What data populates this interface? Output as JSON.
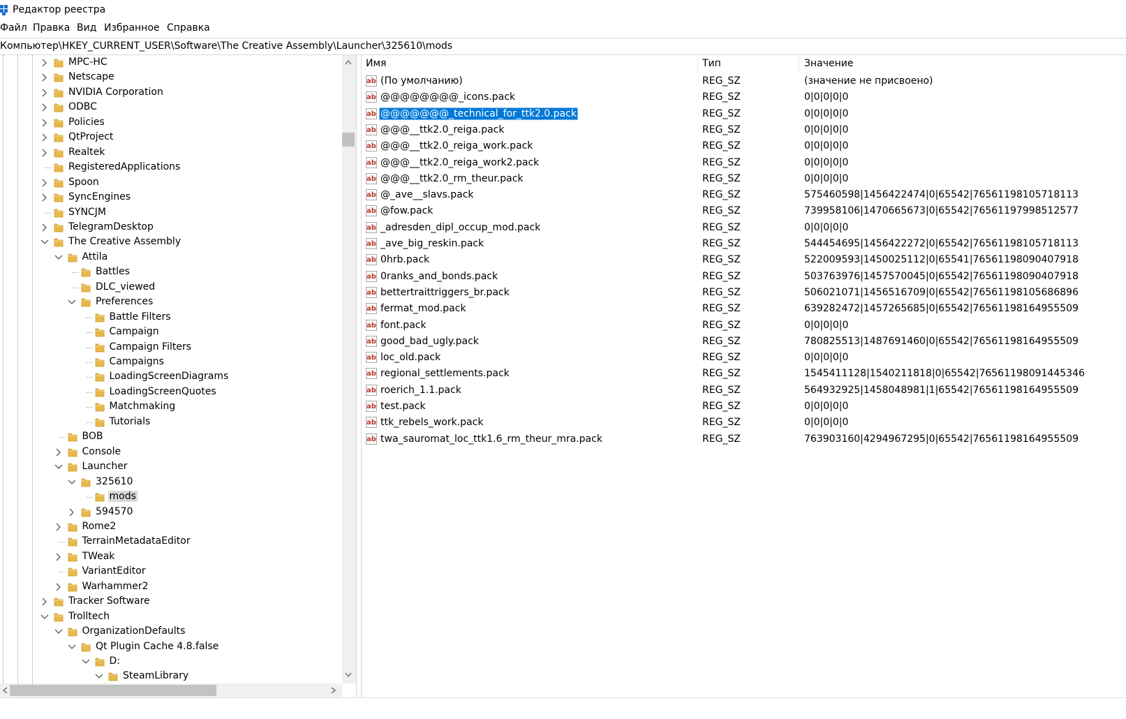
{
  "window": {
    "title": "Редактор реестра"
  },
  "menu": [
    "Файл",
    "Правка",
    "Вид",
    "Избранное",
    "Справка"
  ],
  "address": "Компьютер\\HKEY_CURRENT_USER\\Software\\The Creative Assembly\\Launcher\\325610\\mods",
  "tree": [
    {
      "label": "MPC-HC",
      "depth": 0,
      "state": "collapsed"
    },
    {
      "label": "Netscape",
      "depth": 0,
      "state": "collapsed"
    },
    {
      "label": "NVIDIA Corporation",
      "depth": 0,
      "state": "collapsed"
    },
    {
      "label": "ODBC",
      "depth": 0,
      "state": "collapsed"
    },
    {
      "label": "Policies",
      "depth": 0,
      "state": "collapsed"
    },
    {
      "label": "QtProject",
      "depth": 0,
      "state": "collapsed"
    },
    {
      "label": "Realtek",
      "depth": 0,
      "state": "collapsed"
    },
    {
      "label": "RegisteredApplications",
      "depth": 0,
      "state": "leaf"
    },
    {
      "label": "Spoon",
      "depth": 0,
      "state": "collapsed"
    },
    {
      "label": "SyncEngines",
      "depth": 0,
      "state": "collapsed"
    },
    {
      "label": "SYNCJM",
      "depth": 0,
      "state": "leaf"
    },
    {
      "label": "TelegramDesktop",
      "depth": 0,
      "state": "collapsed"
    },
    {
      "label": "The Creative Assembly",
      "depth": 0,
      "state": "expanded"
    },
    {
      "label": "Attila",
      "depth": 1,
      "state": "expanded"
    },
    {
      "label": "Battles",
      "depth": 2,
      "state": "leaf"
    },
    {
      "label": "DLC_viewed",
      "depth": 2,
      "state": "leaf"
    },
    {
      "label": "Preferences",
      "depth": 2,
      "state": "expanded"
    },
    {
      "label": "Battle Filters",
      "depth": 3,
      "state": "leaf"
    },
    {
      "label": "Campaign",
      "depth": 3,
      "state": "leaf"
    },
    {
      "label": "Campaign Filters",
      "depth": 3,
      "state": "leaf"
    },
    {
      "label": "Campaigns",
      "depth": 3,
      "state": "leaf"
    },
    {
      "label": "LoadingScreenDiagrams",
      "depth": 3,
      "state": "leaf"
    },
    {
      "label": "LoadingScreenQuotes",
      "depth": 3,
      "state": "leaf"
    },
    {
      "label": "Matchmaking",
      "depth": 3,
      "state": "leaf"
    },
    {
      "label": "Tutorials",
      "depth": 3,
      "state": "leaf"
    },
    {
      "label": "BOB",
      "depth": 1,
      "state": "leaf"
    },
    {
      "label": "Console",
      "depth": 1,
      "state": "collapsed"
    },
    {
      "label": "Launcher",
      "depth": 1,
      "state": "expanded"
    },
    {
      "label": "325610",
      "depth": 2,
      "state": "expanded"
    },
    {
      "label": "mods",
      "depth": 3,
      "state": "leaf",
      "selected": true
    },
    {
      "label": "594570",
      "depth": 2,
      "state": "collapsed"
    },
    {
      "label": "Rome2",
      "depth": 1,
      "state": "collapsed"
    },
    {
      "label": "TerrainMetadataEditor",
      "depth": 1,
      "state": "leaf"
    },
    {
      "label": "TWeak",
      "depth": 1,
      "state": "collapsed"
    },
    {
      "label": "VariantEditor",
      "depth": 1,
      "state": "leaf"
    },
    {
      "label": "Warhammer2",
      "depth": 1,
      "state": "collapsed"
    },
    {
      "label": "Tracker Software",
      "depth": 0,
      "state": "collapsed"
    },
    {
      "label": "Trolltech",
      "depth": 0,
      "state": "expanded"
    },
    {
      "label": "OrganizationDefaults",
      "depth": 1,
      "state": "expanded"
    },
    {
      "label": "Qt Plugin Cache 4.8.false",
      "depth": 2,
      "state": "expanded"
    },
    {
      "label": "D:",
      "depth": 3,
      "state": "expanded"
    },
    {
      "label": "SteamLibrary",
      "depth": 4,
      "state": "expanded"
    }
  ],
  "list": {
    "headers": {
      "name": "Имя",
      "type": "Тип",
      "data": "Значение"
    },
    "rows": [
      {
        "name": "(По умолчанию)",
        "type": "REG_SZ",
        "data": "(значение не присвоено)"
      },
      {
        "name": "@@@@@@@@_icons.pack",
        "type": "REG_SZ",
        "data": "0|0|0|0|0"
      },
      {
        "name": "@@@@@@@_technical_for_ttk2.0.pack",
        "type": "REG_SZ",
        "data": "0|0|0|0|0",
        "selected": true
      },
      {
        "name": "@@@__ttk2.0_reiga.pack",
        "type": "REG_SZ",
        "data": "0|0|0|0|0"
      },
      {
        "name": "@@@__ttk2.0_reiga_work.pack",
        "type": "REG_SZ",
        "data": "0|0|0|0|0"
      },
      {
        "name": "@@@__ttk2.0_reiga_work2.pack",
        "type": "REG_SZ",
        "data": "0|0|0|0|0"
      },
      {
        "name": "@@@__ttk2.0_rm_theur.pack",
        "type": "REG_SZ",
        "data": "0|0|0|0|0"
      },
      {
        "name": "@_ave__slavs.pack",
        "type": "REG_SZ",
        "data": "575460598|1456422474|0|65542|76561198105718113"
      },
      {
        "name": "@fow.pack",
        "type": "REG_SZ",
        "data": "739958106|1470665673|0|65542|76561197998512577"
      },
      {
        "name": "_adresden_dipl_occup_mod.pack",
        "type": "REG_SZ",
        "data": "0|0|0|0|0"
      },
      {
        "name": "_ave_big_reskin.pack",
        "type": "REG_SZ",
        "data": "544454695|1456422272|0|65542|76561198105718113"
      },
      {
        "name": "0hrb.pack",
        "type": "REG_SZ",
        "data": "522009593|1450025112|0|65541|76561198090407918"
      },
      {
        "name": "0ranks_and_bonds.pack",
        "type": "REG_SZ",
        "data": "503763976|1457570045|0|65542|76561198090407918"
      },
      {
        "name": "bettertraittriggers_br.pack",
        "type": "REG_SZ",
        "data": "506021071|1456516709|0|65542|76561198105686896"
      },
      {
        "name": "fermat_mod.pack",
        "type": "REG_SZ",
        "data": "639282472|1457265685|0|65542|76561198164955509"
      },
      {
        "name": "font.pack",
        "type": "REG_SZ",
        "data": "0|0|0|0|0"
      },
      {
        "name": "good_bad_ugly.pack",
        "type": "REG_SZ",
        "data": "780825513|1487691460|0|65542|76561198164955509"
      },
      {
        "name": "loc_old.pack",
        "type": "REG_SZ",
        "data": "0|0|0|0|0"
      },
      {
        "name": "regional_settlements.pack",
        "type": "REG_SZ",
        "data": "1545411128|1540211818|0|65542|76561198091445346"
      },
      {
        "name": "roerich_1.1.pack",
        "type": "REG_SZ",
        "data": "564932925|1458048981|1|65542|76561198164955509"
      },
      {
        "name": "test.pack",
        "type": "REG_SZ",
        "data": "0|0|0|0|0"
      },
      {
        "name": "ttk_rebels_work.pack",
        "type": "REG_SZ",
        "data": "0|0|0|0|0"
      },
      {
        "name": "twa_sauromat_loc_ttk1.6_rm_theur_mra.pack",
        "type": "REG_SZ",
        "data": "763903160|4294967295|0|65542|76561198164955509"
      }
    ]
  },
  "icons": {
    "value_icon": "reg-string-icon",
    "folder_icon": "folder-icon"
  },
  "colors": {
    "selection": "#0078d7",
    "folder": "#e8b84a",
    "tree_selected": "#d9d9d9"
  }
}
